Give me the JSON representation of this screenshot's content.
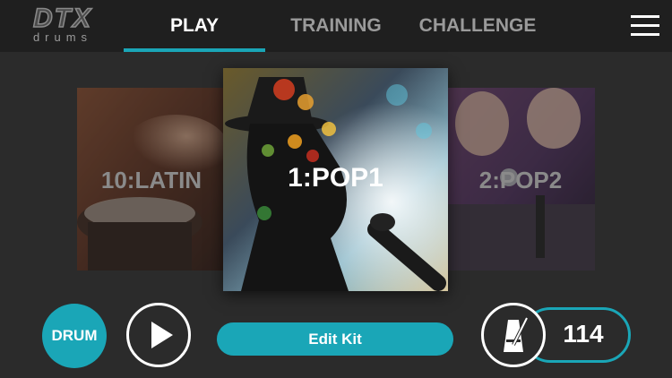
{
  "header": {
    "logo_text": "DTX",
    "logo_subtext": "drums",
    "tabs": [
      {
        "label": "PLAY",
        "active": true
      },
      {
        "label": "TRAINING",
        "active": false
      },
      {
        "label": "CHALLENGE",
        "active": false
      }
    ],
    "menu_icon": "hamburger-menu-icon"
  },
  "carousel": {
    "items": [
      {
        "label": "10:LATIN",
        "position": "left"
      },
      {
        "label": "1:POP1",
        "position": "center",
        "selected": true
      },
      {
        "label": "2:POP2",
        "position": "right"
      }
    ]
  },
  "controls": {
    "drum_label": "DRUM",
    "play_icon": "play-icon",
    "edit_kit_label": "Edit Kit",
    "metronome_icon": "metronome-icon",
    "tempo": "114"
  },
  "colors": {
    "accent": "#1aa6b7",
    "background": "#2b2b2b",
    "topbar": "#1f1f1f"
  }
}
